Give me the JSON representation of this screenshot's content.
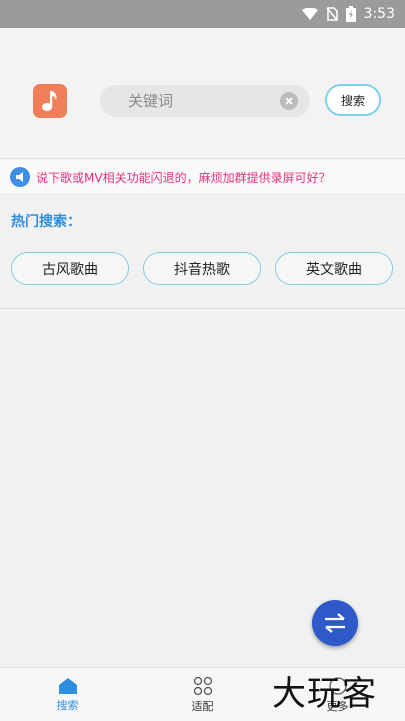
{
  "status_bar": {
    "time": "3:53"
  },
  "header": {
    "search_placeholder": "关键词",
    "search_button": "搜索"
  },
  "notice": {
    "text": "说下歌或MV相关功能闪退的，麻烦加群提供录屏可好？"
  },
  "hot": {
    "title": "热门搜索：",
    "chips": [
      "古风歌曲",
      "抖音热歌",
      "英文歌曲"
    ]
  },
  "nav": {
    "items": [
      {
        "label": "搜索",
        "icon": "home-icon",
        "active": true
      },
      {
        "label": "适配",
        "icon": "grid-circles-icon",
        "active": false
      },
      {
        "label": "更多",
        "icon": "more-icon",
        "active": false
      }
    ]
  },
  "watermark": "大玩客",
  "colors": {
    "accent": "#2e8fe0",
    "notice_text": "#e5317c",
    "logo": "#f07e58",
    "fab": "#2f59c9",
    "chip_border": "#82cbe5"
  }
}
